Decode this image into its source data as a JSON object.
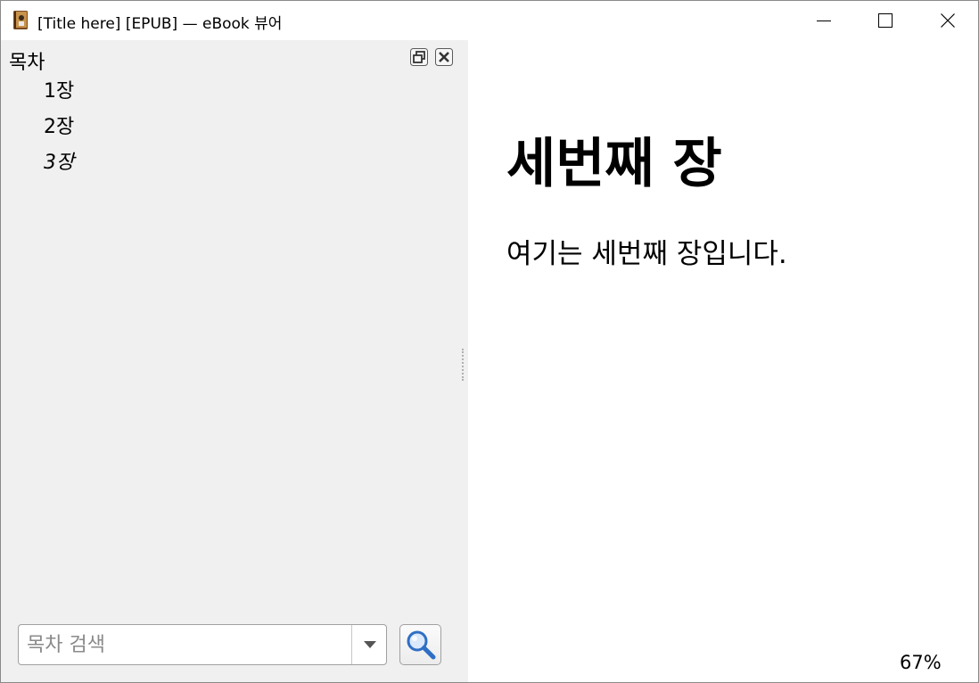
{
  "window": {
    "title": "[Title here] [EPUB] — eBook 뷰어",
    "app_icon": "ebook-viewer-icon",
    "controls": {
      "minimize_icon": "minimize-icon",
      "maximize_icon": "maximize-icon",
      "close_icon": "close-icon"
    }
  },
  "toc": {
    "dock_title": "목차",
    "float_icon": "undock-icon",
    "close_icon": "dock-close-icon",
    "items": [
      {
        "label": "1장",
        "current": false
      },
      {
        "label": "2장",
        "current": false
      },
      {
        "label": "3장",
        "current": true
      }
    ],
    "search": {
      "value": "",
      "placeholder": "목차 검색",
      "dropdown_icon": "chevron-down-icon",
      "button_icon": "magnifier-icon"
    }
  },
  "reader": {
    "chapter_title": "세번째 장",
    "body_text": "여기는 세번째 장입니다.",
    "progress": "67%"
  },
  "colors": {
    "sidebar_bg": "#f0f0f0",
    "search_icon_blue": "#2f6fc5"
  }
}
